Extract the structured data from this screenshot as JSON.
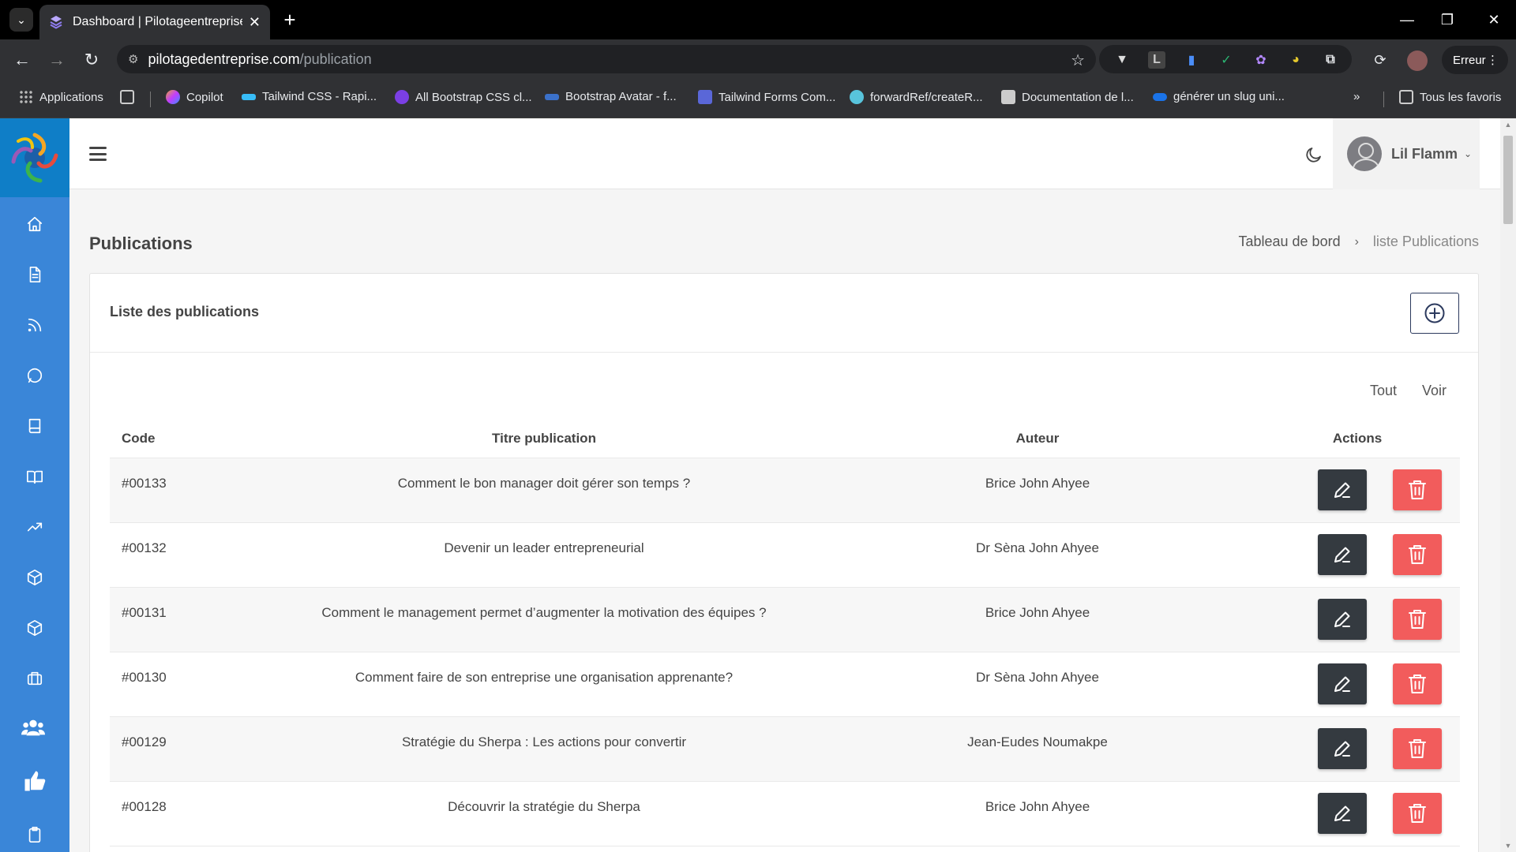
{
  "browser": {
    "tab_title": "Dashboard | Pilotageentreprise",
    "url_host": "pilotagedentreprise.com",
    "url_path": "/publication",
    "profile_button": "Erreur",
    "bookmarks": [
      {
        "label": "Applications",
        "color": "#4285f4"
      },
      {
        "label": "Copilot",
        "color": "#e8a23a"
      },
      {
        "label": "Tailwind CSS - Rapi...",
        "color": "#38bdf8"
      },
      {
        "label": "All Bootstrap CSS cl...",
        "color": "#7b3fe4"
      },
      {
        "label": "Bootstrap Avatar - f...",
        "color": "#3b71ca"
      },
      {
        "label": "Tailwind Forms Com...",
        "color": "#5a67d8"
      },
      {
        "label": "forwardRef/createR...",
        "color": "#58c4dc"
      },
      {
        "label": "Documentation de l...",
        "color": "#cccccc"
      },
      {
        "label": "générer un slug uni...",
        "color": "#1a73e8"
      }
    ],
    "all_bookmarks": "Tous les favoris"
  },
  "header": {
    "user_name": "Lil Flamm"
  },
  "page": {
    "title": "Publications",
    "breadcrumb": [
      "Tableau de bord",
      "liste Publications"
    ]
  },
  "card": {
    "title": "Liste des publications",
    "toggle_all": "Tout",
    "toggle_view": "Voir"
  },
  "table": {
    "headers": [
      "Code",
      "Titre publication",
      "Auteur",
      "Actions"
    ],
    "rows": [
      {
        "code": "#00133",
        "title": "Comment le bon manager doit gérer son temps ?",
        "author": "Brice John Ahyee"
      },
      {
        "code": "#00132",
        "title": "Devenir un leader entrepreneurial",
        "author": "Dr Sèna John Ahyee"
      },
      {
        "code": "#00131",
        "title": "Comment le management permet d’augmenter la motivation des équipes ?",
        "author": "Brice John Ahyee"
      },
      {
        "code": "#00130",
        "title": "Comment faire de son entreprise une organisation apprenante?",
        "author": "Dr Sèna John Ahyee"
      },
      {
        "code": "#00129",
        "title": "Stratégie du Sherpa : Les actions pour convertir",
        "author": "Jean-Eudes Noumakpe"
      },
      {
        "code": "#00128",
        "title": "Découvrir la stratégie du Sherpa",
        "author": "Brice John Ahyee"
      }
    ]
  },
  "colors": {
    "sidebar": "#3a86d8",
    "logo_bg": "#0f7ec7",
    "edit_button": "#343a40",
    "delete_button": "#f25c5c",
    "add_button_border": "#2c3a5e"
  }
}
